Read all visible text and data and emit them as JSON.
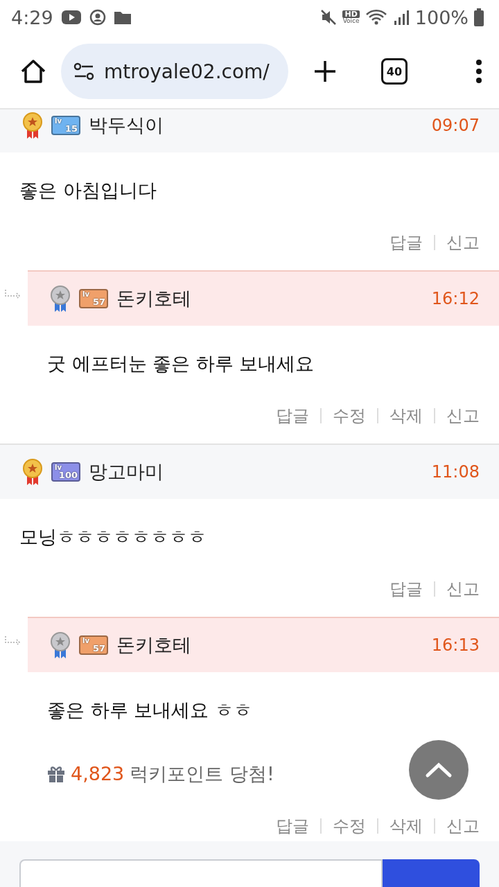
{
  "status_bar": {
    "time": "4:29",
    "hd_label": "HD",
    "voice_label": "Voice",
    "battery": "100%"
  },
  "browser": {
    "url": "mtroyale02.com/",
    "tab_count": "40"
  },
  "comments": [
    {
      "kind": "comment",
      "medal": {
        "kind": "gold"
      },
      "badge": {
        "prefix": "lv",
        "number": "15",
        "color": "#6fb3f0"
      },
      "author": "박두식이",
      "time": "09:07",
      "body": "좋은 아침입니다",
      "actions": [
        "답글",
        "신고"
      ]
    },
    {
      "kind": "reply",
      "medal": {
        "kind": "silver"
      },
      "badge": {
        "prefix": "lv",
        "number": "57",
        "color": "#f0a06a"
      },
      "author": "돈키호테",
      "time": "16:12",
      "body": "굿 에프터눈 좋은 하루 보내세요",
      "actions": [
        "답글",
        "수정",
        "삭제",
        "신고"
      ]
    },
    {
      "kind": "comment",
      "medal": {
        "kind": "gold"
      },
      "badge": {
        "prefix": "lv",
        "number": "100",
        "color": "#8c8fe8"
      },
      "author": "망고마미",
      "time": "11:08",
      "body": "모닝ㅎㅎㅎㅎㅎㅎㅎㅎ",
      "actions": [
        "답글",
        "신고"
      ]
    },
    {
      "kind": "reply",
      "medal": {
        "kind": "silver"
      },
      "badge": {
        "prefix": "lv",
        "number": "57",
        "color": "#f0a06a"
      },
      "author": "돈키호테",
      "time": "16:13",
      "body": "좋은 하루 보내세요 ㅎㅎ",
      "lucky": {
        "points": "4,823",
        "text": "럭키포인트 당첨!"
      },
      "actions": [
        "답글",
        "수정",
        "삭제",
        "신고"
      ]
    }
  ]
}
